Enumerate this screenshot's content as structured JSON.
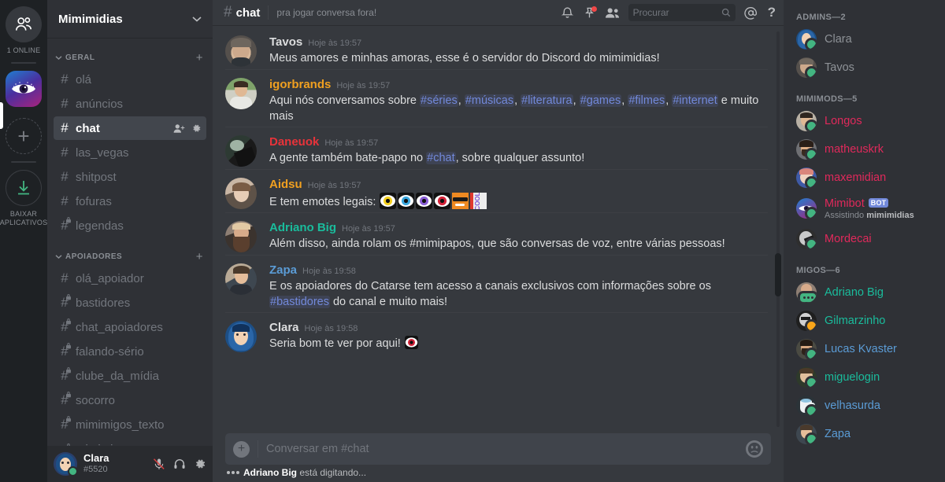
{
  "rail": {
    "home_icon": "friends-icon",
    "online_label": "1 ONLINE",
    "server_icon": "eye-server-icon",
    "add_label": "+",
    "download_label": "BAIXAR APLICATIVOS"
  },
  "sidebar": {
    "guild_name": "Mimimidias",
    "categories": [
      {
        "label": "GERAL",
        "channels": [
          {
            "name": "olá",
            "type": "text",
            "locked": false,
            "selected": false
          },
          {
            "name": "anúncios",
            "type": "text",
            "locked": false,
            "selected": false
          },
          {
            "name": "chat",
            "type": "text",
            "locked": false,
            "selected": true
          },
          {
            "name": "las_vegas",
            "type": "text",
            "locked": false,
            "selected": false
          },
          {
            "name": "shitpost",
            "type": "text",
            "locked": false,
            "selected": false
          },
          {
            "name": "fofuras",
            "type": "text",
            "locked": false,
            "selected": false
          },
          {
            "name": "legendas",
            "type": "text",
            "locked": true,
            "selected": false
          }
        ]
      },
      {
        "label": "APOIADORES",
        "channels": [
          {
            "name": "olá_apoiador",
            "type": "text",
            "locked": false,
            "selected": false
          },
          {
            "name": "bastidores",
            "type": "text",
            "locked": true,
            "selected": false
          },
          {
            "name": "chat_apoiadores",
            "type": "text",
            "locked": true,
            "selected": false
          },
          {
            "name": "falando-sério",
            "type": "text",
            "locked": true,
            "selected": false
          },
          {
            "name": "clube_da_mídia",
            "type": "text",
            "locked": true,
            "selected": false
          },
          {
            "name": "socorro",
            "type": "text",
            "locked": true,
            "selected": false
          },
          {
            "name": "mimimigos_texto",
            "type": "text",
            "locked": true,
            "selected": false
          },
          {
            "name": "mimimigos_voz",
            "type": "voice",
            "locked": true,
            "selected": false
          }
        ]
      }
    ],
    "user": {
      "name": "Clara",
      "tag": "#5520",
      "mic_icon": "mic-muted-icon",
      "headset_icon": "headphones-icon",
      "settings_icon": "gear-icon"
    }
  },
  "header": {
    "hash": "#",
    "channel": "chat",
    "topic": "pra jogar conversa fora!",
    "icons": [
      "bell-icon",
      "pin-icon",
      "members-icon",
      "mention-icon",
      "help-icon"
    ],
    "search_placeholder": "Procurar"
  },
  "messages": [
    {
      "author": "Tavos",
      "color": "#dcddde",
      "timestamp": "Hoje às 19:57",
      "avatar": "tavos-avatar",
      "parts": [
        {
          "t": "text",
          "v": "Meus amores e minhas amoras, esse é o servidor do Discord do mimimidias!"
        }
      ]
    },
    {
      "author": "igorbrands",
      "color": "#f0a020",
      "timestamp": "Hoje às 19:57",
      "avatar": "igorbrands-avatar",
      "parts": [
        {
          "t": "text",
          "v": "Aqui nós conversamos sobre "
        },
        {
          "t": "mention",
          "v": "#séries"
        },
        {
          "t": "text",
          "v": ", "
        },
        {
          "t": "mention",
          "v": "#músicas"
        },
        {
          "t": "text",
          "v": ", "
        },
        {
          "t": "mention",
          "v": "#literatura"
        },
        {
          "t": "text",
          "v": ", "
        },
        {
          "t": "mention",
          "v": "#games"
        },
        {
          "t": "text",
          "v": ", "
        },
        {
          "t": "mention",
          "v": "#filmes"
        },
        {
          "t": "text",
          "v": ", "
        },
        {
          "t": "mention",
          "v": "#internet"
        },
        {
          "t": "text",
          "v": " e muito mais"
        }
      ]
    },
    {
      "author": "Daneuok",
      "color": "#e8333a",
      "timestamp": "Hoje às 19:57",
      "avatar": "daneuok-avatar",
      "parts": [
        {
          "t": "text",
          "v": "A gente também bate-papo no "
        },
        {
          "t": "mention",
          "v": "#chat"
        },
        {
          "t": "text",
          "v": ", sobre qualquer assunto!"
        }
      ]
    },
    {
      "author": "Aidsu",
      "color": "#f0a020",
      "timestamp": "Hoje às 19:57",
      "avatar": "aidsu-avatar",
      "parts": [
        {
          "t": "text",
          "v": "E tem emotes legais: "
        },
        {
          "t": "emote",
          "v": "eye-yellow-emote"
        },
        {
          "t": "emote",
          "v": "eye-blue-emote"
        },
        {
          "t": "emote",
          "v": "eye-purple-emote"
        },
        {
          "t": "emote",
          "v": "eye-red-emote"
        },
        {
          "t": "emote",
          "v": "cool-face-emote"
        },
        {
          "t": "emote",
          "v": "cool-text-emote"
        }
      ]
    },
    {
      "author": "Adriano Big",
      "color": "#1abc9c",
      "timestamp": "Hoje às 19:57",
      "avatar": "adrianobig-avatar",
      "parts": [
        {
          "t": "text",
          "v": "Além disso, ainda rolam os #mimipapos, que são conversas de voz, entre várias pessoas!"
        }
      ]
    },
    {
      "author": "Zapa",
      "color": "#5b9cd6",
      "timestamp": "Hoje às 19:58",
      "avatar": "zapa-avatar",
      "parts": [
        {
          "t": "text",
          "v": "E os apoiadores do Catarse tem acesso a canais exclusivos com informações sobre os "
        },
        {
          "t": "mention",
          "v": "#bastidores"
        },
        {
          "t": "text",
          "v": " do canal e muito mais!"
        }
      ]
    },
    {
      "author": "Clara",
      "color": "#dcddde",
      "timestamp": "Hoje às 19:58",
      "avatar": "clara-avatar",
      "parts": [
        {
          "t": "text",
          "v": "Seria bom te ver por aqui! "
        },
        {
          "t": "emote",
          "v": "eye-red-emote"
        }
      ]
    }
  ],
  "composer": {
    "placeholder": "Conversar em #chat",
    "plus_icon": "add-attachment-icon",
    "emoji_icon": "emoji-picker-icon",
    "typing_text_prefix": "Adriano Big",
    "typing_text_suffix": " está digitando..."
  },
  "members": {
    "groups": [
      {
        "label": "ADMINS—2",
        "people": [
          {
            "name": "Clara",
            "color": "#8e9297",
            "status": "online",
            "avatar": "clara-avatar"
          },
          {
            "name": "Tavos",
            "color": "#8e9297",
            "status": "online",
            "avatar": "tavos-avatar"
          }
        ]
      },
      {
        "label": "MIMIMODS—5",
        "people": [
          {
            "name": "Longos",
            "color": "#e0295b",
            "status": "online",
            "avatar": "longos-avatar"
          },
          {
            "name": "matheuskrk",
            "color": "#e0295b",
            "status": "online",
            "avatar": "matheuskrk-avatar"
          },
          {
            "name": "maxemidian",
            "color": "#e0295b",
            "status": "online",
            "avatar": "maxemidian-avatar"
          },
          {
            "name": "Mimibot",
            "color": "#e0295b",
            "status": "online",
            "avatar": "mimibot-avatar",
            "badge": "BOT",
            "sub_prefix": "Assistindo ",
            "sub_strong": "mimimidias"
          },
          {
            "name": "Mordecai",
            "color": "#e0295b",
            "status": "online",
            "avatar": "mordecai-avatar"
          }
        ]
      },
      {
        "label": "MIGOS—6",
        "people": [
          {
            "name": "Adriano Big",
            "color": "#1abc9c",
            "status": "typing",
            "avatar": "adrianobig-avatar"
          },
          {
            "name": "Gilmarzinho",
            "color": "#1abc9c",
            "status": "idle",
            "avatar": "gilmarzinho-avatar"
          },
          {
            "name": "Lucas Kvaster",
            "color": "#5b9cd6",
            "status": "online",
            "avatar": "lucaskvaster-avatar"
          },
          {
            "name": "miguelogin",
            "color": "#1abc9c",
            "status": "online",
            "avatar": "miguelogin-avatar"
          },
          {
            "name": "velhasurda",
            "color": "#5b9cd6",
            "status": "online",
            "avatar": "velhasurda-avatar"
          },
          {
            "name": "Zapa",
            "color": "#5b9cd6",
            "status": "online",
            "avatar": "zapa-avatar"
          }
        ]
      }
    ]
  }
}
